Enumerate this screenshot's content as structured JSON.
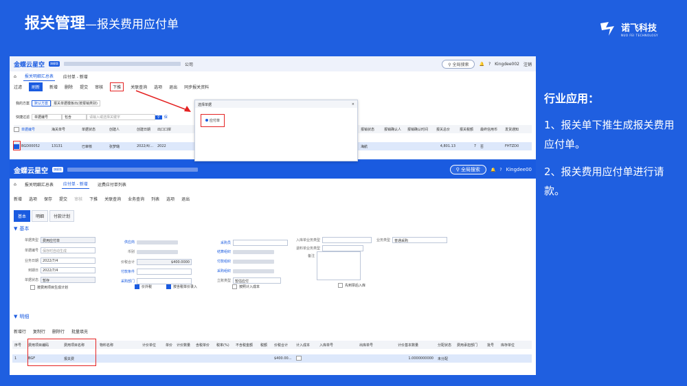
{
  "slide": {
    "title_main": "报关管理",
    "title_sub": "—报关费用应付单",
    "brand_name": "诺飞科技",
    "brand_en": "NUO FEI TECHNOLOGY",
    "side_heading": "行业应用：",
    "side_points": [
      "1、报关单下推生成报关费用应付单。",
      "2、报关费用应付单进行请款。"
    ]
  },
  "shot1": {
    "app_name": "金蝶云星空",
    "trial_badge": "旗舰版",
    "company_suffix": "公司",
    "search": "全局搜索",
    "user": "Kingdee002",
    "logout": "注销",
    "tabs": [
      "报关明细汇总表",
      "应付单 - 新增"
    ],
    "toolbar": [
      "过滤",
      "刷新",
      "新增",
      "删除",
      "提交",
      "审核",
      "下推",
      "关联查询",
      "选项",
      "退出",
      "同步报关资料"
    ],
    "scheme_label": "我的方案",
    "scheme_default": "默认方案",
    "scheme_other": "报关单据模板出(按报销类别)",
    "quick_filter_label": "快捷过滤",
    "quick_filter_field": "单据编号",
    "quick_filter_op": "包含",
    "quick_filter_placeholder": "请输入或选择关键字",
    "save_link": "保",
    "columns": [
      "单据编号",
      "海关单号",
      "单据状态",
      "创建人",
      "创建日期",
      "出口口岸"
    ],
    "row": [
      "BGD00052",
      "13131",
      "已审核",
      "张梦璐",
      "2022/4/...",
      "2022"
    ],
    "right_columns": [
      "报销状态",
      "报销确认人",
      "报销确认时间",
      "报关总价",
      "报关税额",
      "最终信用币",
      "发货通知"
    ],
    "right_row": [
      "海航",
      "",
      "",
      "4,801.13",
      "7",
      "否",
      "FHTZD0"
    ],
    "dialog_title": "选择单据",
    "dialog_close": "×",
    "dialog_option": "应付单"
  },
  "shot2": {
    "app_name": "金蝶云星空",
    "trial_badge": "旗舰版",
    "search": "全局搜索",
    "user": "Kingdee00",
    "tabs": [
      "报关明细汇总表",
      "应付单 - 新增",
      "运费应付单列表"
    ],
    "toolbar": [
      "新增",
      "选项",
      "保存",
      "提交",
      "审核",
      "下推",
      "关联查询",
      "业务查询",
      "列表",
      "选项",
      "退出"
    ],
    "subtabs": [
      "基本",
      "明细",
      "付款计划"
    ],
    "section_basic": "基本",
    "section_detail": "明细",
    "fields": {
      "doc_type_label": "单据类型",
      "doc_type": "费用应付单",
      "doc_no_label": "单据编号",
      "doc_no": "保存时自动生成",
      "biz_date_label": "业务日期",
      "biz_date": "2022/7/4",
      "due_date_label": "到期日",
      "due_date": "2022/7/4",
      "status_label": "单据状态",
      "status": "暂存",
      "supplier_label": "供应商",
      "currency_label": "币别",
      "total_tax_label": "价税合计",
      "total_tax": "$400.0000",
      "pay_terms_label": "付款条件",
      "buy_dept_label": "采购部门",
      "price_tax_label": "价外税",
      "tax_included_label": "按含税单价录入",
      "buyer_label": "采购员",
      "settle_org_label": "结算组织",
      "pay_org_label": "付款组织",
      "buy_org_label": "采购组织",
      "dr_label": "立账类型",
      "dr": "暂估应付",
      "cost_label": "按照计入成本",
      "in_biz_label": "入库单业务类型",
      "return_biz_label": "退料单业务类型",
      "remark_label": "备注",
      "biz_type_label": "业务类型",
      "biz_type": "普通采购",
      "first_biz_label": "先到票后入库",
      "purchase_plan_label": "按费用项目生成计划"
    },
    "detail_toolbar": [
      "新增行",
      "复制行",
      "删除行",
      "批量填充"
    ],
    "detail_columns": [
      "序号",
      "费用项目编码",
      "费用项目名称",
      "物料名称",
      "计价单位",
      "单价",
      "计价数量",
      "含税单价",
      "税率(%)",
      "不含税金额",
      "税额",
      "价税合计",
      "计入成本",
      "入库单号",
      "出库单号",
      "计价基本数量",
      "分配状态",
      "费用承担部门",
      "批号",
      "库存单位"
    ],
    "detail_row": [
      "1",
      "BGF",
      "报关费",
      "",
      "",
      "",
      "",
      "",
      "",
      "",
      "",
      "$400.00...",
      "",
      "",
      "",
      "1.0000000000",
      "未分配",
      "",
      "",
      ""
    ]
  },
  "colors": {
    "slide_bg": "#1f5fe0",
    "accent": "#1a5be0",
    "highlight": "#e42121"
  }
}
